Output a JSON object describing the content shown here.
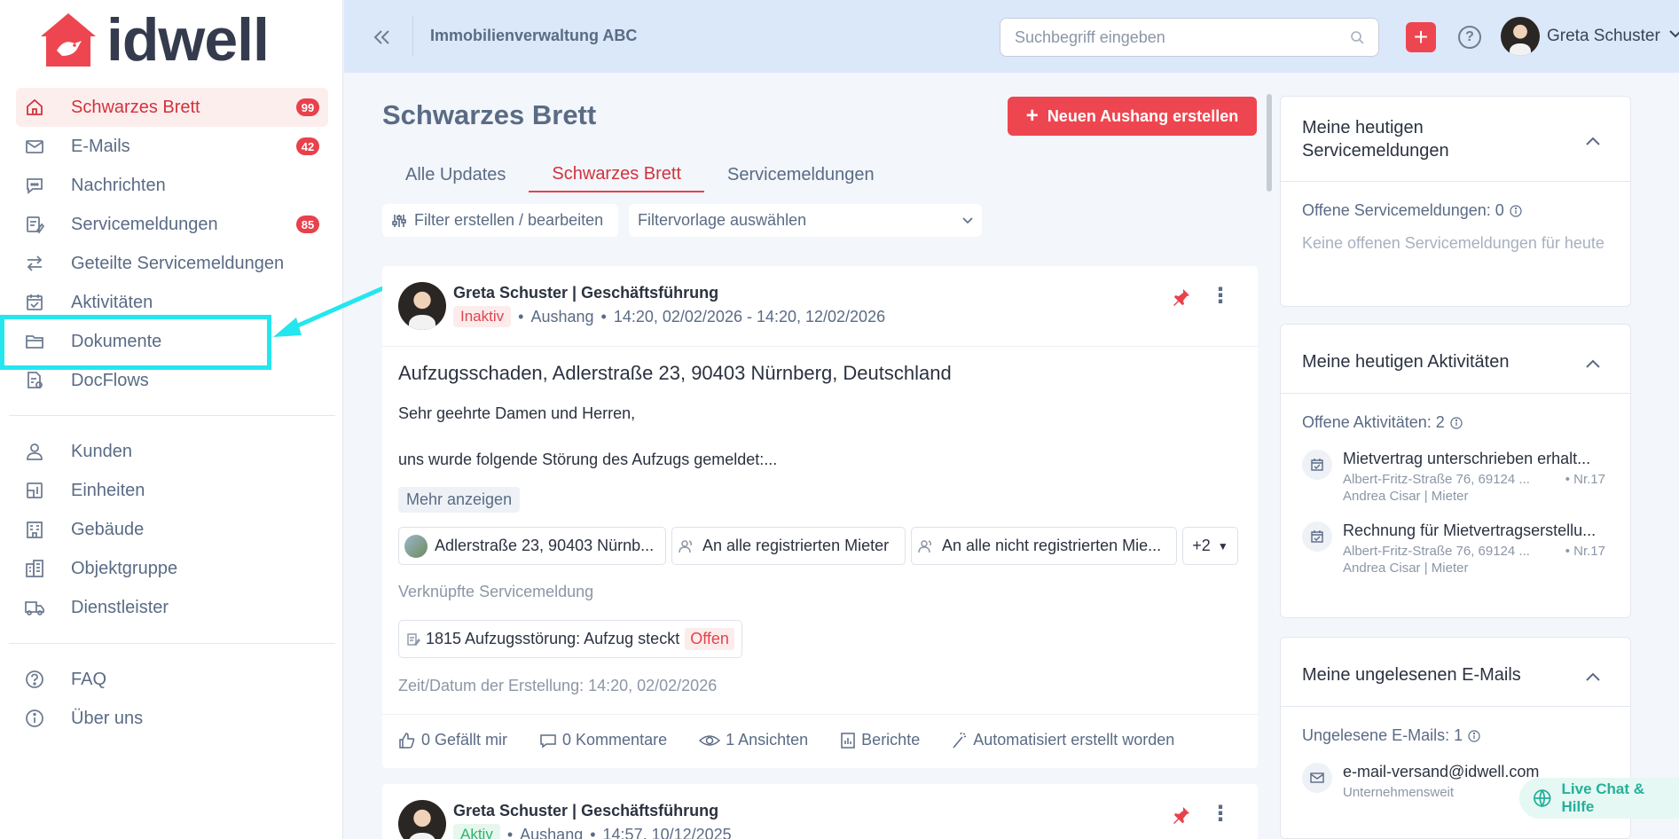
{
  "brand": {
    "name": "idwell",
    "accent": "#ee4650"
  },
  "sidebar": {
    "items": [
      {
        "label": "Schwarzes Brett",
        "icon": "home-icon",
        "badge": "99",
        "active": true
      },
      {
        "label": "E-Mails",
        "icon": "mail-icon",
        "badge": "42"
      },
      {
        "label": "Nachrichten",
        "icon": "chat-icon"
      },
      {
        "label": "Servicemeldungen",
        "icon": "service-icon",
        "badge": "85"
      },
      {
        "label": "Geteilte Servicemeldungen",
        "icon": "share-arrows-icon"
      },
      {
        "label": "Aktivitäten",
        "icon": "calendar-icon"
      },
      {
        "label": "Dokumente",
        "icon": "folder-icon"
      },
      {
        "label": "DocFlows",
        "icon": "docflow-icon"
      }
    ],
    "items2": [
      {
        "label": "Kunden",
        "icon": "person-icon"
      },
      {
        "label": "Einheiten",
        "icon": "unit-icon"
      },
      {
        "label": "Gebäude",
        "icon": "building-icon"
      },
      {
        "label": "Objektgruppe",
        "icon": "buildings-icon"
      },
      {
        "label": "Dienstleister",
        "icon": "truck-icon"
      }
    ],
    "items3": [
      {
        "label": "FAQ",
        "icon": "question-icon"
      },
      {
        "label": "Über uns",
        "icon": "info-icon"
      }
    ]
  },
  "topbar": {
    "org": "Immobilienverwaltung ABC",
    "search_placeholder": "Suchbegriff eingeben",
    "user": "Greta Schuster"
  },
  "main": {
    "title": "Schwarzes Brett",
    "new_button": "Neuen Aushang erstellen",
    "tabs": [
      "Alle Updates",
      "Schwarzes Brett",
      "Servicemeldungen"
    ],
    "filter_button": "Filter erstellen / bearbeiten",
    "filter_select": "Filtervorlage auswählen"
  },
  "post": {
    "author": "Greta Schuster | Geschäftsführung",
    "status": "Inaktiv",
    "type": "Aushang",
    "period": "14:20, 02/02/2026 - 14:20, 12/02/2026",
    "title": "Aufzugsschaden, Adlerstraße 23, 90403 Nürnberg, Deutschland",
    "body1": "Sehr geehrte Damen und Herren,",
    "body2": "uns wurde folgende Störung des Aufzugs gemeldet:...",
    "more": "Mehr anzeigen",
    "chips": [
      "Adlerstraße 23, 90403 Nürnb...",
      "An alle registrierten Mieter",
      "An alle nicht registrierten Mie...",
      "+2"
    ],
    "linked_label": "Verknüpfte Servicemeldung",
    "linked": "1815 Aufzugsstörung: Aufzug steckt",
    "linked_status": "Offen",
    "created": "Zeit/Datum der Erstellung: 14:20, 02/02/2026",
    "actions": {
      "likes": "0 Gefällt mir",
      "comments": "0 Kommentare",
      "views": "1 Ansichten",
      "reports": "Berichte",
      "auto": "Automatisiert erstellt worden"
    }
  },
  "post2": {
    "author": "Greta Schuster | Geschäftsführung",
    "status": "Aktiv",
    "type": "Aushang",
    "period": "14:57, 10/12/2025"
  },
  "right": {
    "card1": {
      "title": "Meine heutigen Servicemeldungen",
      "count": "Offene Servicemeldungen: 0",
      "empty": "Keine offenen Servicemeldungen für heute"
    },
    "card2": {
      "title": "Meine heutigen Aktivitäten",
      "count": "Offene Aktivitäten: 2",
      "items": [
        {
          "title": "Mietvertrag unterschrieben erhalt...",
          "addr": "Albert-Fritz-Straße 76, 69124 ...",
          "nr": "Nr.17",
          "person": "Andrea Cisar | Mieter"
        },
        {
          "title": "Rechnung für Mietvertragserstellu...",
          "addr": "Albert-Fritz-Straße 76, 69124 ...",
          "nr": "Nr.17",
          "person": "Andrea Cisar | Mieter"
        }
      ]
    },
    "card3": {
      "title": "Meine ungelesenen E-Mails",
      "count": "Ungelesene E-Mails: 1",
      "email": "e-mail-versand@idwell.com",
      "scope": "Unternehmensweit"
    }
  },
  "livechat": "Live Chat & Hilfe"
}
